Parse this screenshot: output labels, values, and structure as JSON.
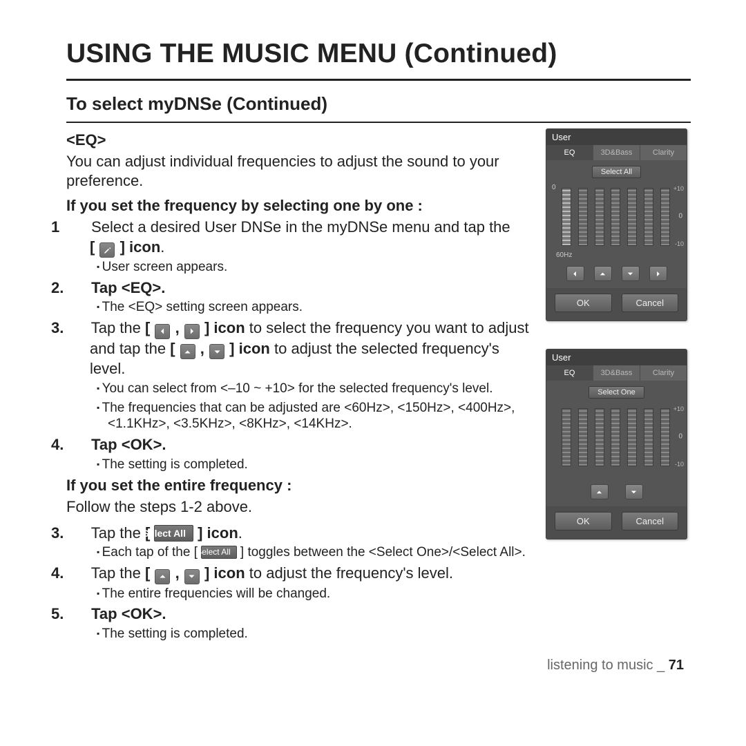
{
  "page_title": "USING THE MUSIC MENU (Continued)",
  "section": "To select myDNSe (Continued)",
  "eq_heading": "<EQ>",
  "eq_intro": "You can adjust individual frequencies to adjust the sound to your preference.",
  "branch_a_heading": "If you set the frequency by selecting one by one :",
  "step_a1_a": "Select a desired User DNSe in the myDNSe menu and tap the ",
  "icon_word": "icon",
  "period": ".",
  "sub_a1": "User screen appears.",
  "step_a2": "Tap <EQ>.",
  "sub_a2": "The <EQ> setting screen appears.",
  "step_a3_a": "Tap the ",
  "step_a3_b": " to select the frequency you want to adjust and tap the ",
  "step_a3_c": " to adjust the selected frequency's level.",
  "sub_a3_1": "You can select from <–10 ~ +10> for the selected frequency's level.",
  "sub_a3_2": "The frequencies that can be adjusted are <60Hz>, <150Hz>, <400Hz>, <1.1KHz>, <3.5KHz>, <8KHz>, <14KHz>.",
  "step_a4": "Tap <OK>.",
  "sub_a4": "The setting is completed.",
  "branch_b_heading": "If you set the entire frequency :",
  "branch_b_follow": "Follow the steps 1-2 above.",
  "step_b3_a": "Tap the ",
  "sub_b3_a_1": "Each tap of the [",
  "sub_b3_a_2": "] toggles between the <Select One>/<Select All>.",
  "step_b4_a": "Tap the ",
  "step_b4_b": " to adjust the frequency's level.",
  "sub_b4": "The entire frequencies will be changed.",
  "step_b5": "Tap <OK>.",
  "sub_b5": "The setting is completed.",
  "chip_label": "Select All",
  "footer_text": "listening to music _ ",
  "footer_page": "71",
  "device1": {
    "title": "User",
    "tabs": [
      "EQ",
      "3D&Bass",
      "Clarity"
    ],
    "chip": "Select All",
    "scale_zero": "0",
    "scale_p10": "+10",
    "scale_m10": "-10",
    "scale_mid": "0",
    "freq_label": "60Hz",
    "ok": "OK",
    "cancel": "Cancel"
  },
  "device2": {
    "title": "User",
    "tabs": [
      "EQ",
      "3D&Bass",
      "Clarity"
    ],
    "chip": "Select One",
    "scale_p10": "+10",
    "scale_m10": "-10",
    "scale_mid": "0",
    "ok": "OK",
    "cancel": "Cancel"
  },
  "num": {
    "n1": "1",
    "n2": "2.",
    "n3": "3.",
    "n4": "4.",
    "n5": "5."
  },
  "bracket_open": "[",
  "bracket_close": "]",
  "comma": ","
}
